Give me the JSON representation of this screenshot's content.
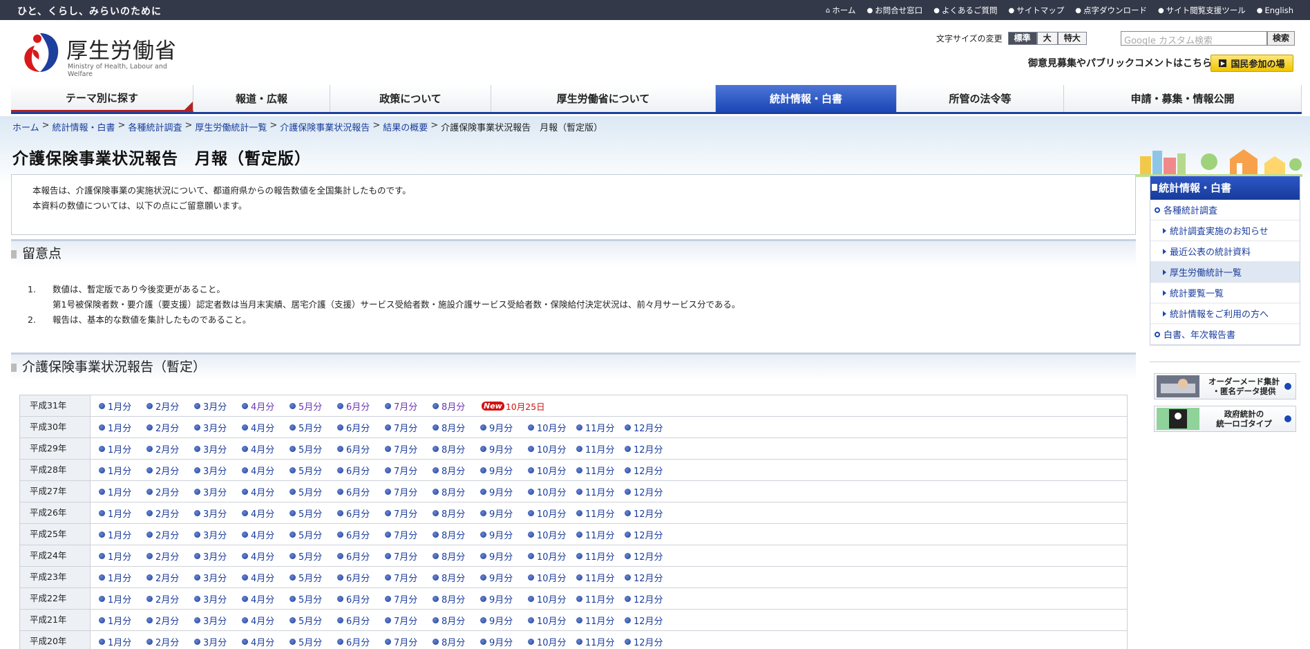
{
  "topbar": {
    "tagline": "ひと、くらし、みらいのために",
    "links": [
      {
        "icon": "home-icon",
        "label": "ホーム"
      },
      {
        "icon": "circle-icon",
        "label": "お問合せ窓口"
      },
      {
        "icon": "circle-icon",
        "label": "よくあるご質問"
      },
      {
        "icon": "circle-icon",
        "label": "サイトマップ"
      },
      {
        "icon": "circle-icon",
        "label": "点字ダウンロード"
      },
      {
        "icon": "circle-icon",
        "label": "サイト閲覧支援ツール"
      },
      {
        "icon": "globe-icon",
        "label": "English"
      }
    ]
  },
  "header": {
    "logo_name": "厚生労働省",
    "logo_eng": "Ministry of Health, Labour and Welfare",
    "fontsize_label": "文字サイズの変更",
    "fontsize_options": [
      "標準",
      "大",
      "特大"
    ],
    "search_placeholder": "Google カスタム検索",
    "search_button": "検索",
    "public_text": "御意見募集やパブリックコメントはこちら",
    "public_button": "国民参加の場"
  },
  "gnav": [
    "テーマ別に探す",
    "報道・広報",
    "政策について",
    "厚生労働省について",
    "統計情報・白書",
    "所管の法令等",
    "申請・募集・情報公開"
  ],
  "breadcrumb": [
    "ホーム",
    "統計情報・白書",
    "各種統計調査",
    "厚生労働統計一覧",
    "介護保険事業状況報告",
    "結果の概要",
    "介護保険事業状況報告　月報（暫定版）"
  ],
  "page": {
    "title": "介護保険事業状況報告　月報（暫定版）",
    "intro1": "本報告は、介護保険事業の実施状況について、都道府県からの報告数値を全国集計したものです。",
    "intro2": "本資料の数値については、以下の点にご留意願います。"
  },
  "notes": {
    "heading": "留意点",
    "items": [
      {
        "num": "1.",
        "text": "数値は、暫定版であり今後変更があること。"
      },
      {
        "num": "",
        "text": "第1号被保険者数・要介護（要支援）認定者数は当月末実績、居宅介護（支援）サービス受給者数・施設介護サービス受給者数・保険給付決定状況は、前々月サービス分である。"
      },
      {
        "num": "2.",
        "text": "報告は、基本的な数値を集計したものであること。"
      }
    ]
  },
  "reports": {
    "heading": "介護保険事業状況報告（暫定）",
    "new_label": "New",
    "new_date": "10月25日",
    "months": [
      "1月分",
      "2月分",
      "3月分",
      "4月分",
      "5月分",
      "6月分",
      "7月分",
      "8月分",
      "9月分",
      "10月分",
      "11月分",
      "12月分"
    ],
    "years": [
      "平成31年",
      "平成30年",
      "平成29年",
      "平成28年",
      "平成27年",
      "平成26年",
      "平成25年",
      "平成24年",
      "平成23年",
      "平成22年",
      "平成21年",
      "平成20年"
    ]
  },
  "sidebar": {
    "title": "統計情報・白書",
    "items": [
      {
        "label": "各種統計調査",
        "level": 1
      },
      {
        "label": "統計調査実施のお知らせ",
        "level": 2
      },
      {
        "label": "最近公表の統計資料",
        "level": 2
      },
      {
        "label": "厚生労働統計一覧",
        "level": 2,
        "selected": true
      },
      {
        "label": "統計要覧一覧",
        "level": 2
      },
      {
        "label": "統計情報をご利用の方へ",
        "level": 2
      },
      {
        "label": "白書、年次報告書",
        "level": 1
      }
    ],
    "banner1_line1": "オーダーメード集計",
    "banner1_line2": "・匿名データ提供",
    "banner2_line1": "政府統計の",
    "banner2_line2": "統一ロゴタイプ"
  },
  "colors": {
    "nav_active": "#1a47b5",
    "topbar": "#34394a",
    "new_badge": "#d21010"
  }
}
